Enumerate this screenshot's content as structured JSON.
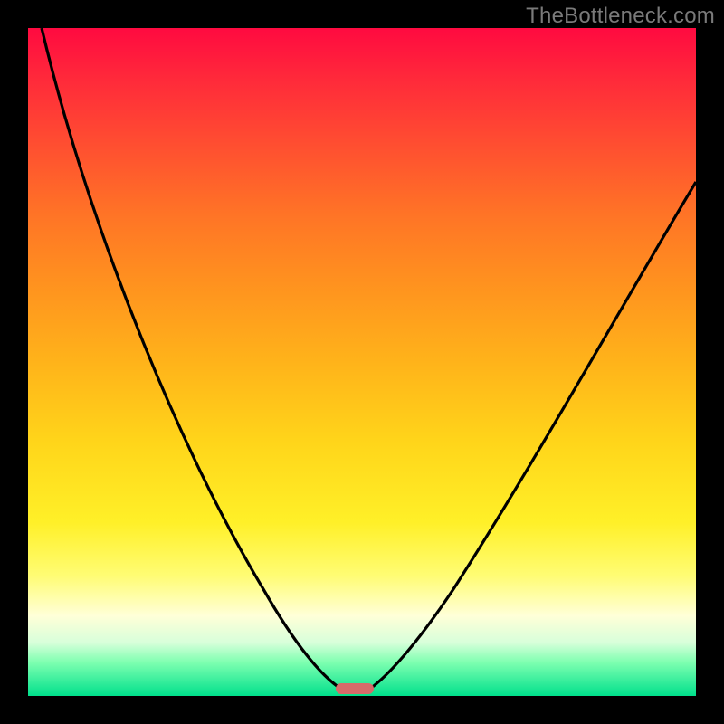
{
  "watermark": "TheBottleneck.com",
  "chart_data": {
    "type": "line",
    "title": "",
    "xlabel": "",
    "ylabel": "",
    "xlim": [
      0,
      100
    ],
    "ylim": [
      0,
      100
    ],
    "series": [
      {
        "name": "left-curve",
        "x": [
          2,
          5,
          8,
          12,
          16,
          20,
          24,
          28,
          32,
          36,
          40,
          43,
          45,
          47,
          48.5
        ],
        "values": [
          100,
          90,
          80,
          70,
          60,
          50,
          41,
          33,
          26,
          19,
          13,
          8,
          5,
          2.5,
          1
        ]
      },
      {
        "name": "right-curve",
        "x": [
          51.5,
          53,
          55,
          58,
          62,
          66,
          70,
          75,
          80,
          85,
          90,
          95,
          100
        ],
        "values": [
          1,
          2.5,
          5,
          9,
          15,
          22,
          30,
          39,
          48,
          57,
          65,
          71,
          77
        ]
      }
    ],
    "marker": {
      "x": 49,
      "width_pct": 5.7
    },
    "gradient_stops": [
      {
        "pos": 0,
        "color": "#ff0a40"
      },
      {
        "pos": 50,
        "color": "#ffb31a"
      },
      {
        "pos": 82,
        "color": "#fffc74"
      },
      {
        "pos": 100,
        "color": "#00e08c"
      }
    ]
  }
}
